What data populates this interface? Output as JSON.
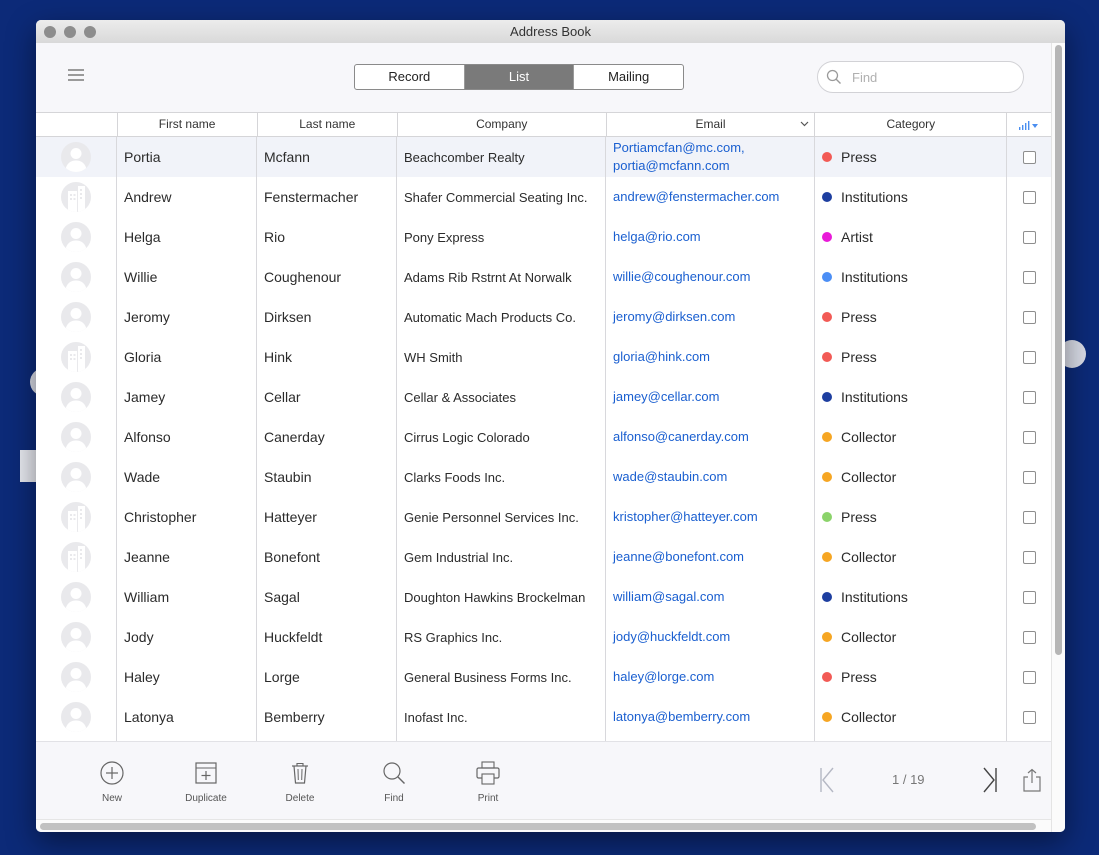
{
  "window": {
    "title": "Address Book"
  },
  "toolbar": {
    "views": [
      "Record",
      "List",
      "Mailing"
    ],
    "active_view": "List",
    "search_placeholder": "Find"
  },
  "columns": [
    "First name",
    "Last name",
    "Company",
    "Email",
    "Category"
  ],
  "category_colors": {
    "Press": "#f25a55",
    "Institutions": "#1e3fa0",
    "Artist": "#e91ad8",
    "Institutions-light": "#4b8ef5",
    "Collector": "#f6a623",
    "Press-green": "#8bd36a"
  },
  "rows": [
    {
      "first": "Portia",
      "last": "Mcfann",
      "company": "Beachcomber Realty",
      "email": "Portiamcfan@mc.com, portia@mcfann.com",
      "category": "Press",
      "color": "#f25a55",
      "avatar": "person",
      "selected": true
    },
    {
      "first": "Andrew",
      "last": "Fenstermacher",
      "company": "Shafer Commercial Seating Inc.",
      "email": "andrew@fenstermacher.com",
      "category": "Institutions",
      "color": "#1e3fa0",
      "avatar": "building",
      "selected": false
    },
    {
      "first": "Helga",
      "last": "Rio",
      "company": "Pony Express",
      "email": "helga@rio.com",
      "category": "Artist",
      "color": "#e91ad8",
      "avatar": "person",
      "selected": false
    },
    {
      "first": "Willie",
      "last": "Coughenour",
      "company": "Adams Rib Rstrnt At Norwalk",
      "email": "willie@coughenour.com",
      "category": "Institutions",
      "color": "#4b8ef5",
      "avatar": "person",
      "selected": false
    },
    {
      "first": "Jeromy",
      "last": "Dirksen",
      "company": "Automatic Mach Products Co.",
      "email": "jeromy@dirksen.com",
      "category": "Press",
      "color": "#f25a55",
      "avatar": "person",
      "selected": false
    },
    {
      "first": "Gloria",
      "last": "Hink",
      "company": "WH Smith",
      "email": "gloria@hink.com",
      "category": "Press",
      "color": "#f25a55",
      "avatar": "building",
      "selected": false
    },
    {
      "first": "Jamey",
      "last": "Cellar",
      "company": "Cellar & Associates",
      "email": "jamey@cellar.com",
      "category": "Institutions",
      "color": "#1e3fa0",
      "avatar": "person",
      "selected": false
    },
    {
      "first": "Alfonso",
      "last": "Canerday",
      "company": "Cirrus Logic Colorado",
      "email": "alfonso@canerday.com",
      "category": "Collector",
      "color": "#f6a623",
      "avatar": "person",
      "selected": false
    },
    {
      "first": "Wade",
      "last": "Staubin",
      "company": "Clarks Foods Inc.",
      "email": "wade@staubin.com",
      "category": "Collector",
      "color": "#f6a623",
      "avatar": "person",
      "selected": false
    },
    {
      "first": "Christopher",
      "last": "Hatteyer",
      "company": "Genie Personnel Services Inc.",
      "email": "kristopher@hatteyer.com",
      "category": "Press",
      "color": "#8bd36a",
      "avatar": "building",
      "selected": false
    },
    {
      "first": "Jeanne",
      "last": "Bonefont",
      "company": "Gem Industrial Inc.",
      "email": "jeanne@bonefont.com",
      "category": "Collector",
      "color": "#f6a623",
      "avatar": "building",
      "selected": false
    },
    {
      "first": "William",
      "last": "Sagal",
      "company": "Doughton Hawkins Brockelman",
      "email": "william@sagal.com",
      "category": "Institutions",
      "color": "#1e3fa0",
      "avatar": "person",
      "selected": false
    },
    {
      "first": "Jody",
      "last": "Huckfeldt",
      "company": "RS Graphics Inc.",
      "email": "jody@huckfeldt.com",
      "category": "Collector",
      "color": "#f6a623",
      "avatar": "person",
      "selected": false
    },
    {
      "first": "Haley",
      "last": "Lorge",
      "company": "General Business Forms Inc.",
      "email": "haley@lorge.com",
      "category": "Press",
      "color": "#f25a55",
      "avatar": "person",
      "selected": false
    },
    {
      "first": "Latonya",
      "last": "Bemberry",
      "company": "Inofast Inc.",
      "email": "latonya@bemberry.com",
      "category": "Collector",
      "color": "#f6a623",
      "avatar": "person",
      "selected": false
    }
  ],
  "footer": {
    "new_label": "New",
    "duplicate_label": "Duplicate",
    "delete_label": "Delete",
    "find_label": "Find",
    "print_label": "Print",
    "pager": "1 / 19"
  }
}
